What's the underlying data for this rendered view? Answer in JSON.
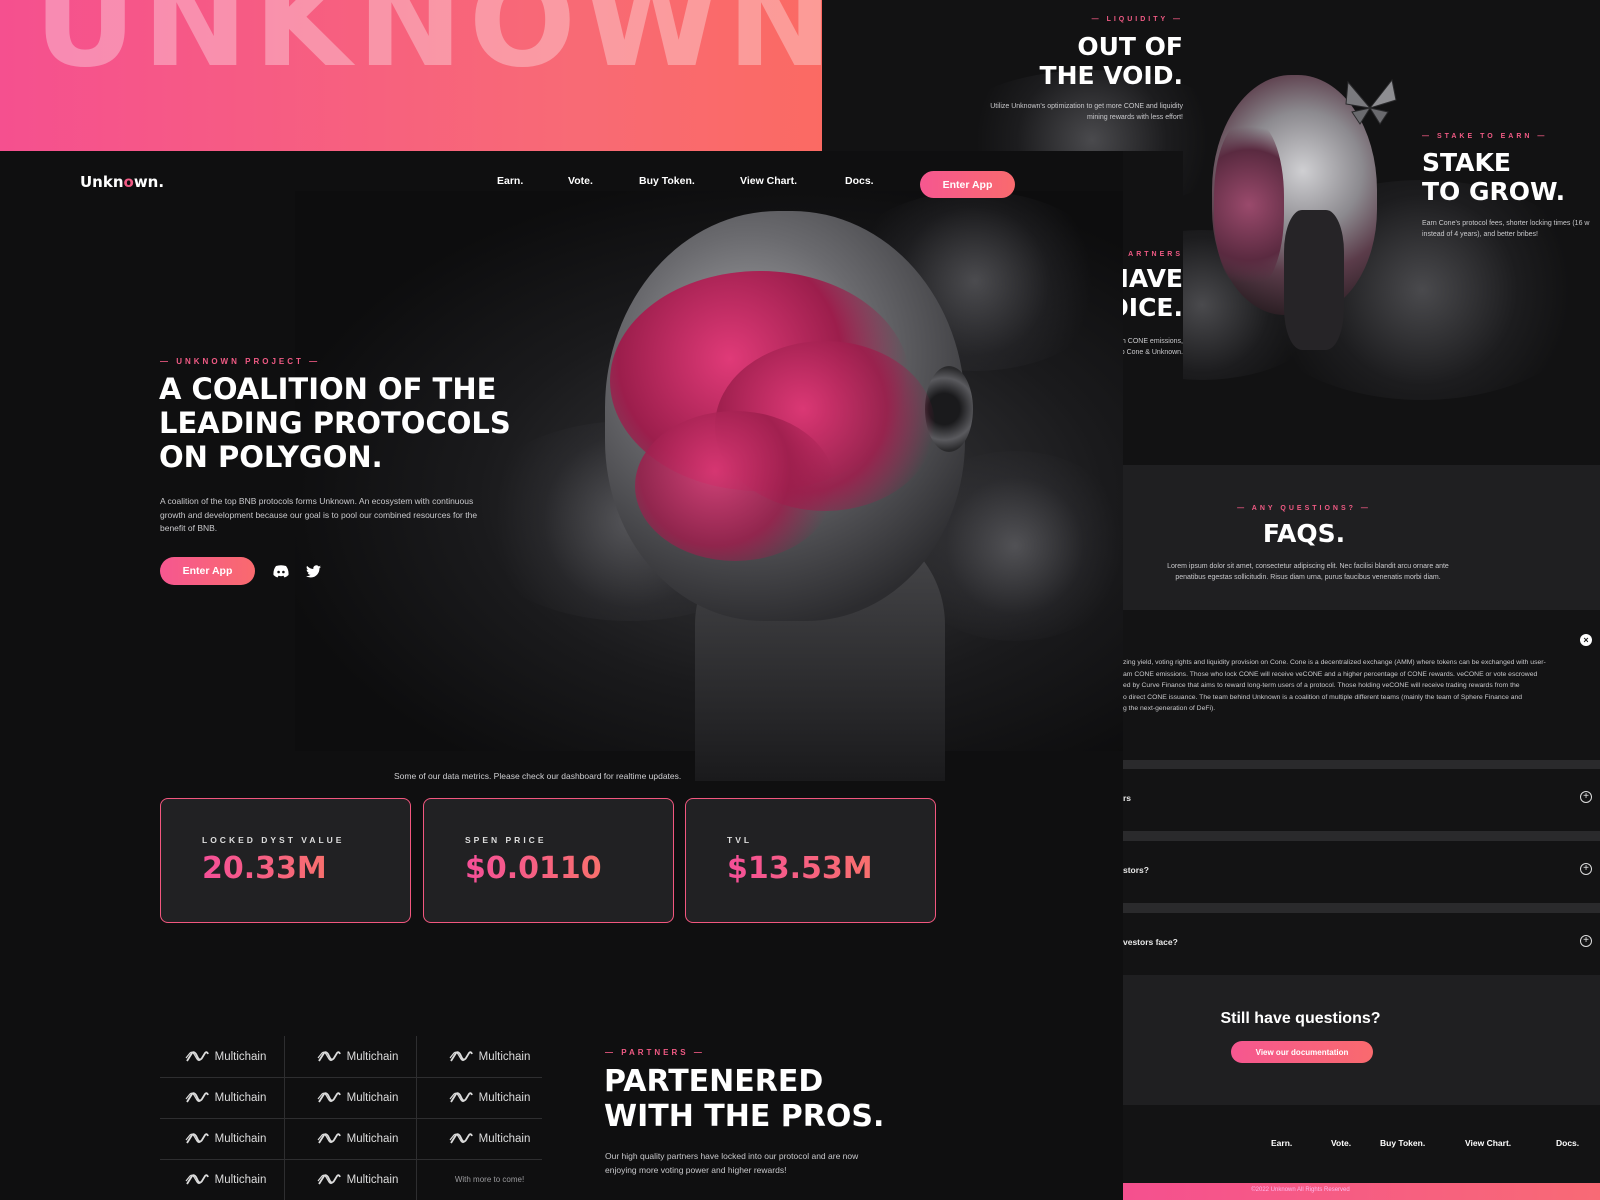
{
  "banner": {
    "word": "UNKNOWN."
  },
  "nav": {
    "logo": "Unkn",
    "logo_o": "o",
    "logo_end": "wn.",
    "links": [
      "Earn.",
      "Vote.",
      "Buy Token.",
      "View Chart.",
      "Docs."
    ],
    "cta": "Enter App"
  },
  "hero": {
    "eyebrow": "— UNKNOWN PROJECT —",
    "title_lines": [
      "A COALITION OF THE",
      "LEADING PROTOCOLS",
      "ON POLYGON."
    ],
    "body": "A coalition of the top BNB protocols forms Unknown. An ecosystem with continuous growth and development because our goal is to pool our combined resources for the benefit of BNB.",
    "cta": "Enter App"
  },
  "metrics": {
    "caption": "Some of our data metrics. Please check our dashboard for realtime updates.",
    "cards": [
      {
        "label": "LOCKED DYST VALUE",
        "value": "20.33M"
      },
      {
        "label": "SPEN PRICE",
        "value": "$0.0110"
      },
      {
        "label": "TVL",
        "value": "$13.53M"
      }
    ]
  },
  "partners": {
    "logo_name": "Multichain",
    "more": "With more to come!",
    "eyebrow": "— PARTNERS —",
    "title_lines": [
      "PARTENERED",
      "WITH THE PROS."
    ],
    "body": "Our high quality partners have locked into our protocol and are now enjoying more voting power and higher rewards!"
  },
  "void": {
    "eyebrow": "— LIQUIDITY —",
    "title_lines": [
      "OUT OF",
      "THE VOID."
    ],
    "body": "Utilize Unknown's optimization to get more CONE and liquidity mining rewards with less effort!"
  },
  "stake": {
    "eyebrow": "— STAKE TO EARN —",
    "title_lines": [
      "STAKE",
      "TO GROW."
    ],
    "body": "Earn Cone's protocol fees, shorter locking times (16 w instead of 4 years), and better bribes!"
  },
  "voice": {
    "eyebrow": "ARTNERS",
    "title_lines": [
      "IAVE",
      "OICE."
    ],
    "body_lines": [
      "n CONE emissions,",
      "p Cone & Unknown."
    ]
  },
  "faqs": {
    "eyebrow": "— ANY QUESTIONS? —",
    "title": "FAQS.",
    "body": "Lorem ipsum dolor sit amet, consectetur adipiscing elit. Nec facilisi blandit arcu ornare ante penatibus egestas sollicitudin. Risus diam urna, purus faucibus venenatis morbi diam.",
    "answer_lines": [
      "zing yield, voting rights and liquidity provision on Cone. Cone is a decentralized exchange (AMM) where tokens can be exchanged with user-",
      "am CONE emissions. Those who lock CONE will receive veCONE and a higher percentage of CONE rewards. veCONE or vote escrowed",
      "ed by Curve Finance that aims to reward long-term users of a protocol. Those holding veCONE will receive trading rewards from the",
      "o direct CONE issuance. The team behind Unknown is a coalition of multiple different teams (mainly the team of Sphere Finance and",
      "g the next-generation of DeFi)."
    ],
    "rows": [
      "rs",
      "stors?",
      "vestors face?"
    ],
    "still_title": "Still have questions?",
    "still_cta": "View our documentation"
  },
  "footer": {
    "links": [
      "Earn.",
      "Vote.",
      "Buy Token.",
      "View Chart.",
      "Docs."
    ],
    "copyright": "©2022 Unknown All Rights Reserved"
  }
}
